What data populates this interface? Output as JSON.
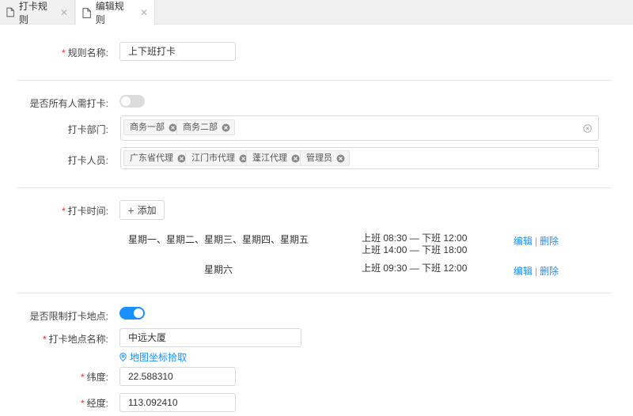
{
  "tabs": [
    {
      "label": "打卡规则"
    },
    {
      "label": "编辑规则"
    }
  ],
  "form": {
    "rule_name": {
      "label": "规则名称:",
      "value": "上下班打卡"
    },
    "all_need_checkin": {
      "label": "是否所有人需打卡:",
      "enabled": false
    },
    "departments": {
      "label": "打卡部门:",
      "tags": [
        "商务一部",
        "商务二部"
      ]
    },
    "people": {
      "label": "打卡人员:",
      "tags": [
        "广东省代理",
        "江门市代理",
        "蓬江代理",
        "管理员"
      ]
    },
    "checkin_time": {
      "label": "打卡时间:",
      "add_label": "添加",
      "schedules": [
        {
          "days": "星期一、星期二、星期三、星期四、星期五",
          "times": [
            "上班 08:30 — 下班 12:00",
            "上班 14:00 — 下班 18:00"
          ]
        },
        {
          "days": "星期六",
          "times": [
            "上班 09:30 — 下班 12:00"
          ]
        }
      ],
      "edit_label": "编辑",
      "delete_label": "删除",
      "separator": "|"
    },
    "limit_location": {
      "label": "是否限制打卡地点:",
      "enabled": true
    },
    "location_name": {
      "label": "打卡地点名称:",
      "value": "中远大厦"
    },
    "map_pick": {
      "label": "地图坐标拾取"
    },
    "latitude": {
      "label": "纬度:",
      "value": "22.588310"
    },
    "longitude": {
      "label": "经度:",
      "value": "113.092410"
    }
  },
  "colors": {
    "accent": "#1890ff",
    "required": "#f5222d"
  }
}
